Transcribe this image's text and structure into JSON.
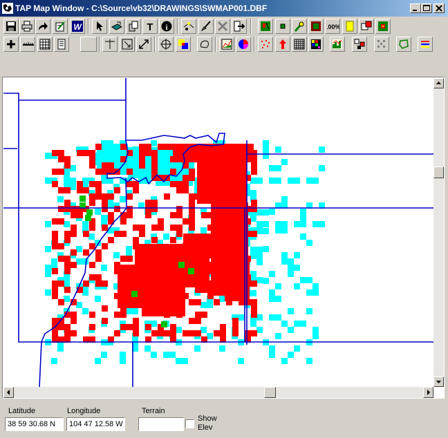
{
  "window": {
    "title": "TAP Map Window - C:\\Source\\vb32\\DRAWINGS\\SWMAP001.DBF"
  },
  "toolbar": {
    "row1": [
      "save-icon",
      "print-icon",
      "redo-arrow-icon",
      "edit-note-icon",
      "w-icon",
      "pointer-icon",
      "layer-icon",
      "stack-icon",
      "text-icon",
      "info-icon",
      "line-tool-icon",
      "brush-icon",
      "delete-icon",
      "exit-icon",
      "green-map-icon",
      "small-square-icon",
      "pin-icon",
      "dark-square-icon",
      "zoom-100-icon",
      "yellow-note-icon",
      "select-red-icon",
      "green-grid-icon"
    ],
    "row2": [
      "plus-icon",
      "ruler-icon",
      "grid-icon",
      "document-icon",
      "blank-button",
      "crosshair-icon",
      "zoom-box-icon",
      "resize-icon",
      "pan-icon",
      "color-layers-icon",
      "lasso-icon",
      "chart-icon",
      "pie-icon",
      "scatter-icon",
      "arrow-up-icon",
      "mesh-icon",
      "color-grid-icon",
      "histogram-icon",
      "cluster-icon",
      "points-icon",
      "polygon-icon",
      "legend-icon"
    ],
    "zoom_label": "100%",
    "text_glyph": "T",
    "info_glyph": "i"
  },
  "map": {
    "colors": {
      "red": "#ff0000",
      "cyan": "#00ffff",
      "green": "#00c000",
      "border": "#0000c8"
    }
  },
  "status": {
    "latitude_label": "Latitude",
    "latitude_value": "38 59 30.68 N",
    "longitude_label": "Longitude",
    "longitude_value": "104 47 12.58 W",
    "terrain_label": "Terrain",
    "terrain_value": "",
    "show_elev_label_1": "Show",
    "show_elev_label_2": "Elev",
    "show_elev_checked": false
  }
}
